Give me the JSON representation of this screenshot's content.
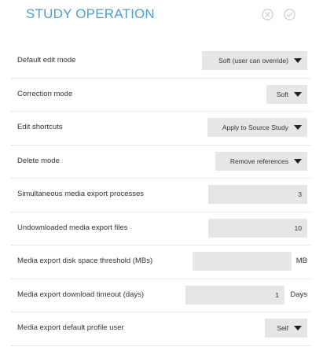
{
  "header": {
    "title": "STUDY OPERATION",
    "cancel_icon": "circle-x-icon",
    "confirm_icon": "circle-check-icon",
    "accent_color": "#4a9fd4",
    "icon_color": "#cccccc"
  },
  "settings": [
    {
      "label": "Default edit mode",
      "type": "select",
      "value": "Soft (user can override)"
    },
    {
      "label": "Correction mode",
      "type": "select",
      "value": "Soft"
    },
    {
      "label": "Edit shortcuts",
      "type": "select",
      "value": "Apply to Source Study"
    },
    {
      "label": "Delete mode",
      "type": "select",
      "value": "Remove references"
    },
    {
      "label": "Simultaneous media export processes",
      "type": "number",
      "value": "3"
    },
    {
      "label": "Undownloaded media export files",
      "type": "number",
      "value": "10"
    },
    {
      "label": "Media export disk space threshold (MBs)",
      "type": "number",
      "value": "",
      "unit": "MB"
    },
    {
      "label": "Media export download timeout (days)",
      "type": "number",
      "value": "1",
      "unit": "Days"
    },
    {
      "label": "Media export default profile user",
      "type": "select",
      "value": "Self"
    }
  ]
}
